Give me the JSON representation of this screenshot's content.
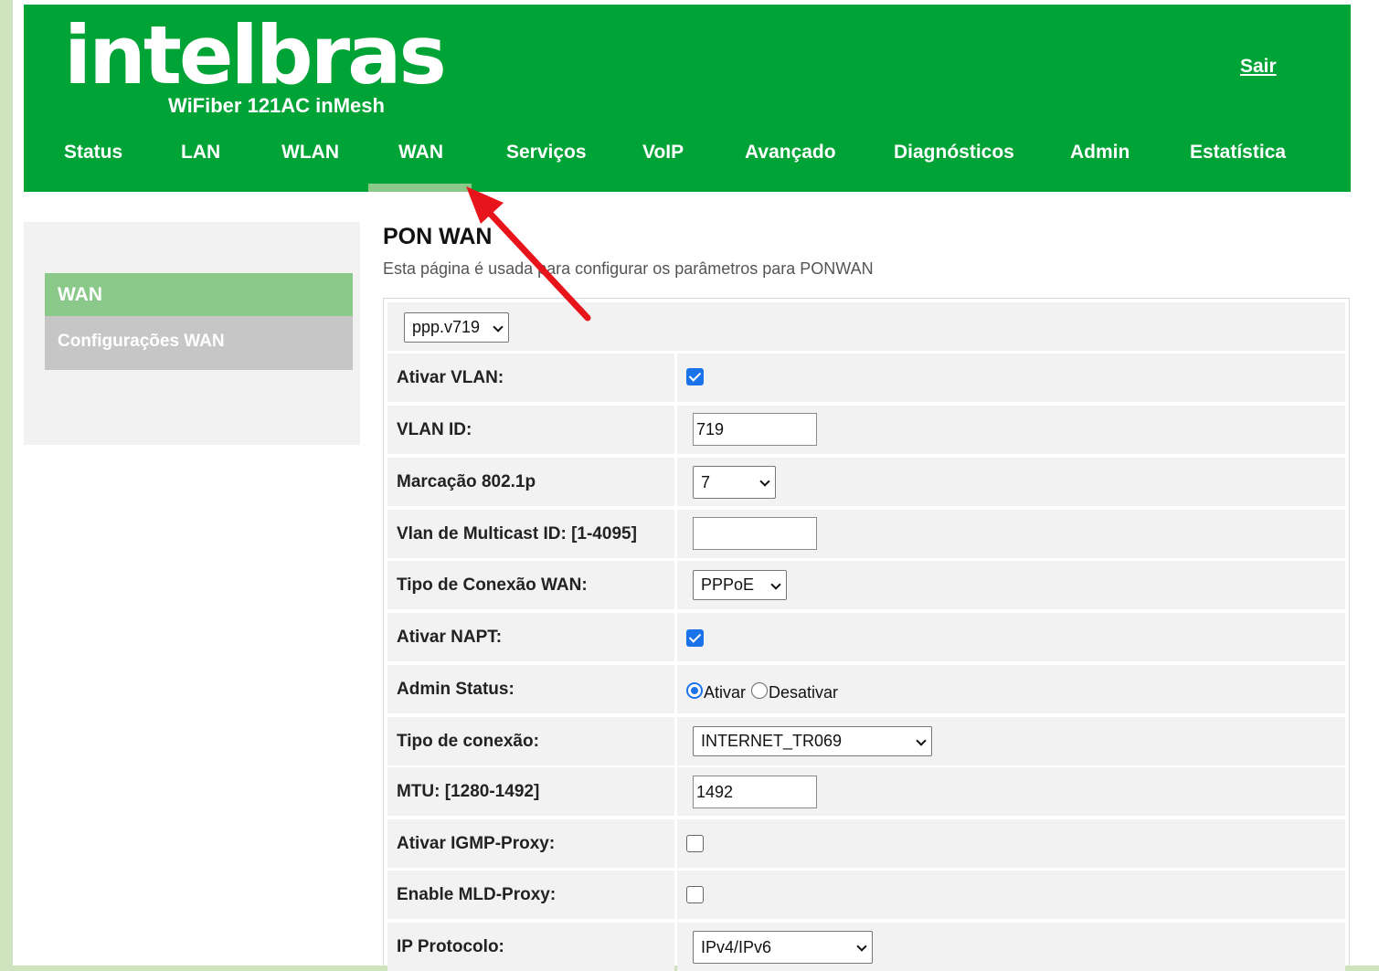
{
  "header": {
    "logo_text": "intelbras",
    "model": "WiFiber 121AC inMesh",
    "logout": "Sair",
    "nav": [
      "Status",
      "LAN",
      "WLAN",
      "WAN",
      "Serviços",
      "VoIP",
      "Avançado",
      "Diagnósticos",
      "Admin",
      "Estatística"
    ],
    "active_tab": "WAN"
  },
  "sidebar": {
    "heading": "WAN",
    "items": [
      "Configurações WAN"
    ]
  },
  "main": {
    "title": "PON WAN",
    "description": "Esta página é usada para configurar os parâmetros para PONWAN",
    "connection_select": "ppp.v719",
    "fields": {
      "vlan_enable": {
        "label": "Ativar VLAN:",
        "checked": true
      },
      "vlan_id": {
        "label": "VLAN ID:",
        "value": "719"
      },
      "marking": {
        "label": "Marcação 802.1p",
        "value": "7"
      },
      "multicast_vlan": {
        "label": "Vlan de Multicast ID: [1-4095]",
        "value": ""
      },
      "wan_type": {
        "label": "Tipo de Conexão WAN:",
        "value": "PPPoE"
      },
      "napt": {
        "label": "Ativar NAPT:",
        "checked": true
      },
      "admin_status": {
        "label": "Admin Status:",
        "options": [
          "Ativar",
          "Desativar"
        ],
        "selected": "Ativar"
      },
      "conn_type": {
        "label": "Tipo de conexão:",
        "value": "INTERNET_TR069"
      },
      "mtu": {
        "label": "MTU: [1280-1492]",
        "value": "1492"
      },
      "igmp_proxy": {
        "label": "Ativar IGMP-Proxy:",
        "checked": false
      },
      "mld_proxy": {
        "label": "Enable MLD-Proxy:",
        "checked": false
      },
      "ip_protocol": {
        "label": "IP Protocolo:",
        "value": "IPv4/IPv6"
      }
    }
  },
  "colors": {
    "brand_green": "#00a335",
    "light_green": "#8bc98a",
    "annotation_arrow": "#e8141b"
  }
}
